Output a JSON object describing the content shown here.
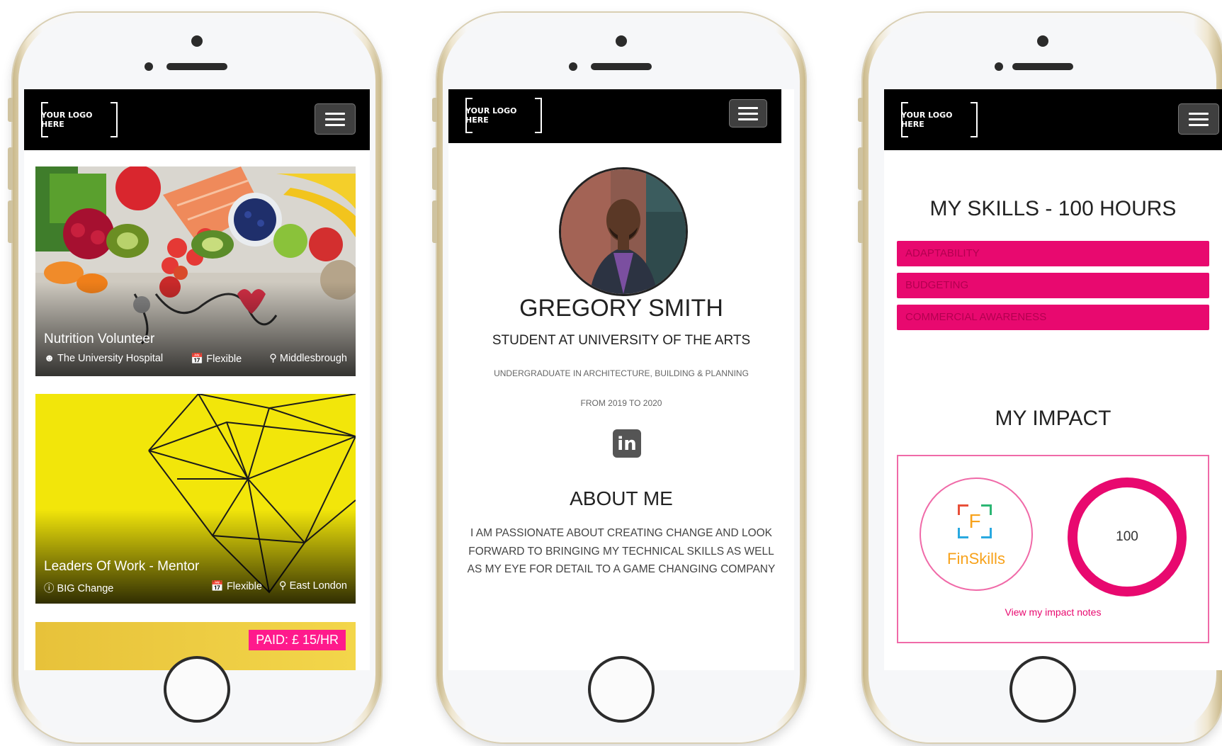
{
  "logo_text": "YOUR LOGO HERE",
  "phone1": {
    "cards": [
      {
        "title": "Nutrition Volunteer",
        "org": "The University Hospital",
        "schedule": "Flexible",
        "location": "Middlesbrough"
      },
      {
        "title": "Leaders Of Work - Mentor",
        "org": "BIG Change",
        "schedule": "Flexible",
        "location": "East London"
      }
    ],
    "paid_badge": "PAID: £ 15/HR"
  },
  "phone2": {
    "name": "GREGORY SMITH",
    "role": "STUDENT AT UNIVERSITY OF THE ARTS",
    "degree": "UNDERGRADUATE IN ARCHITECTURE, BUILDING & PLANNING",
    "dates": "FROM 2019 TO 2020",
    "linkedin_glyph": "in",
    "about_heading": "ABOUT ME",
    "about_text": "I AM PASSIONATE ABOUT CREATING CHANGE AND LOOK FORWARD TO BRINGING MY TECHNICAL SKILLS AS WELL AS MY EYE FOR DETAIL TO A GAME CHANGING COMPANY"
  },
  "phone3": {
    "skills_heading": "MY SKILLS - 100 HOURS",
    "skills": [
      "ADAPTABILITY",
      "BUDGETING",
      "COMMERCIAL AWARENESS"
    ],
    "impact_heading": "MY IMPACT",
    "logo_letter": "F",
    "logo_name": "FinSkills",
    "hours_value": "100",
    "impact_link": "View my impact notes"
  },
  "colors": {
    "accent": "#e8096f",
    "navbar": "#000000",
    "finskills_orange": "#f7a21b"
  }
}
